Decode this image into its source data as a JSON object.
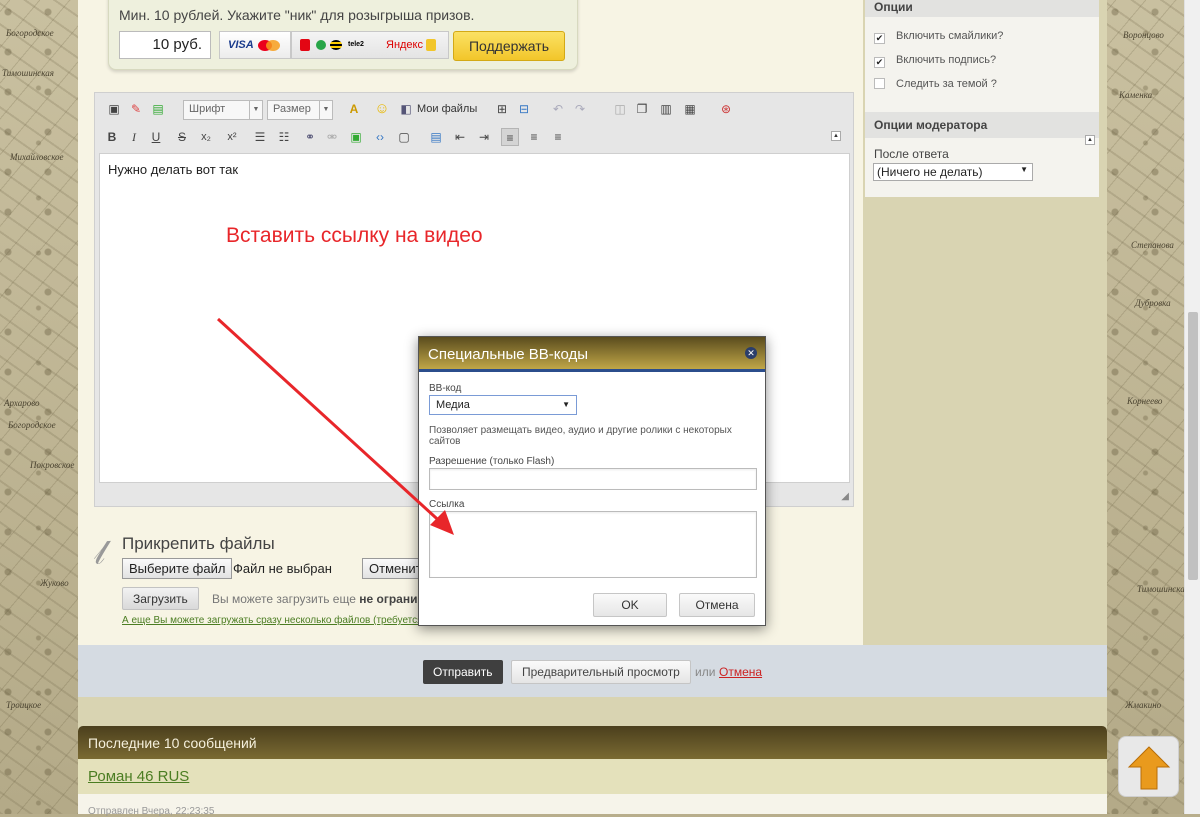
{
  "background": {
    "map_labels": [
      "Богородское",
      "Тимошинская",
      "Михайловское",
      "Архарово",
      "Богородское",
      "Покровское",
      "Жуково",
      "Троицкое",
      "Воронцово",
      "Каменка",
      "Степанова",
      "Дубровка",
      "Корнеево",
      "Тимошинская",
      "Жмакино"
    ]
  },
  "donate": {
    "text": "Мин. 10 рублей. Укажите \"ник\" для розыгрыша призов.",
    "amount": "10 руб.",
    "visa": "VISA",
    "tele2": "tele2",
    "yandex": "Яндекс",
    "support_label": "Поддержать"
  },
  "toolbar": {
    "font_label": "Шрифт",
    "size_label": "Размер",
    "my_files": "Мои файлы",
    "bold": "B",
    "italic": "I",
    "underline": "U",
    "strike": "S",
    "sub": "x₂",
    "sup": "x²"
  },
  "editor": {
    "content": "Нужно делать вот так"
  },
  "annotation": "Вставить ссылку на видео",
  "attach": {
    "title": "Прикрепить файлы",
    "choose_file": "Выберите файл",
    "no_file": "Файл не выбран",
    "cancel": "Отменить",
    "upload": "Загрузить",
    "note_prefix": "Вы можете загрузить еще ",
    "note_bold": "не ограничен",
    "multi_link": "А еще Вы можете загружать сразу несколько файлов (требуется ..."
  },
  "options": {
    "title": "Опции",
    "items": [
      {
        "label": "Включить смайлики?",
        "checked": true
      },
      {
        "label": "Включить подпись?",
        "checked": true
      },
      {
        "label": "Следить за темой ?",
        "checked": false
      }
    ],
    "moderator_title": "Опции модератора",
    "after_reply_label": "После ответа",
    "after_reply_value": "(Ничего не делать)"
  },
  "submit": {
    "send": "Отправить",
    "preview": "Предварительный просмотр",
    "or": "или",
    "cancel": "Отмена"
  },
  "last_messages": {
    "title": "Последние 10 сообщений",
    "user": "Роман 46 RUS",
    "meta": "Отправлен Вчера, 22:23:35"
  },
  "dialog": {
    "title": "Специальные BB-коды",
    "bbcode_label": "BB-код",
    "bbcode_value": "Медиа",
    "description": "Позволяет размещать видео, аудио и другие ролики с некоторых сайтов",
    "resolution_label": "Разрешение (только Flash)",
    "link_label": "Ссылка",
    "ok": "OK",
    "cancel": "Отмена"
  },
  "colors": {
    "accent_red": "#e8262a",
    "link_green": "#4b7d22",
    "header_brown": "#5a4c1e",
    "support_yellow": "#f2c62a"
  }
}
